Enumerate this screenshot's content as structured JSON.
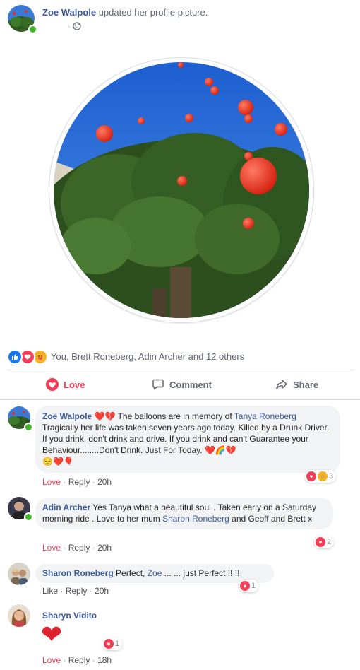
{
  "post": {
    "author": "Zoe Walpole",
    "action_text": "updated her profile picture.",
    "privacy_icon": "globe-icon"
  },
  "reactions_summary": {
    "icons": [
      "like-icon",
      "love-icon",
      "care-icon"
    ],
    "text": "You, Brett Roneberg, Adin Archer and 12 others"
  },
  "actions": {
    "love_label": "Love",
    "comment_label": "Comment",
    "share_label": "Share"
  },
  "comments": [
    {
      "author": "Zoe Walpole",
      "emoji_prefix": "❤️💔",
      "text_a": " The balloons are in memory of ",
      "mention": "Tanya Roneberg",
      "text_b": "Tragically her life was taken,seven years ago today. Killed by a Drunk Driver. If you drink, don't drink and drive. If you drink and can't Guarantee your Behaviour........Don't Drink. Just For Today. ",
      "emoji_suffix": "❤️🌈💔",
      "emoji_line": "😌❤️🎈",
      "love_link": "Love",
      "reply_link": "Reply",
      "time": "20h",
      "reaction_count": "3"
    },
    {
      "author": "Adin Archer",
      "text_a": " Yes Tanya what a beautiful soul . Taken early on a Saturday morning ride . Love to her mum ",
      "mention": "Sharon Roneberg",
      "text_b": " and Geoff and Brett x",
      "love_link": "Love",
      "reply_link": "Reply",
      "time": "20h",
      "reaction_count": "2"
    },
    {
      "author": "Sharon Roneberg",
      "text_a": " Perfect, ",
      "mention": "Zoe",
      "text_b": " ... ... just Perfect !! !!",
      "like_link": "Like",
      "reply_link": "Reply",
      "time": "20h",
      "reaction_count": "1"
    },
    {
      "author": "Sharyn Vidito",
      "sticker": "❤",
      "love_link": "Love",
      "reply_link": "Reply",
      "time": "18h",
      "reaction_count": "1"
    }
  ],
  "colors": {
    "link": "#385898",
    "love": "#f33e58",
    "like": "#1877f2",
    "care": "#f7b125",
    "online": "#42b72a"
  }
}
